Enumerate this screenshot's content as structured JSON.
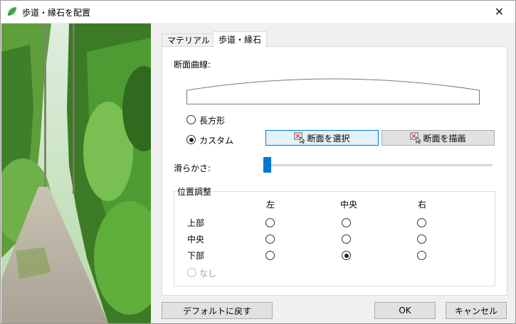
{
  "window": {
    "title": "歩道・縁石を配置",
    "close_glyph": "✕"
  },
  "tabs": [
    {
      "label": "マテリアル",
      "active": false
    },
    {
      "label": "歩道・縁石",
      "active": true
    }
  ],
  "section": {
    "curve_label": "断面曲線:",
    "options": [
      {
        "label": "長方形",
        "checked": false
      },
      {
        "label": "カスタム",
        "checked": true
      }
    ],
    "select_button": "断面を選択",
    "draw_button": "断面を描画",
    "smoothness_label": "滑らかさ:",
    "smoothness_value": 0
  },
  "position": {
    "group_title": "位置調整",
    "columns": [
      "左",
      "中央",
      "右"
    ],
    "rows": [
      "上部",
      "中央",
      "下部"
    ],
    "selected": {
      "row": 2,
      "col": 1
    },
    "none_label": "なし"
  },
  "footer": {
    "default_button": "デフォルトに戻す",
    "ok_button": "OK",
    "cancel_button": "キャンセル"
  },
  "colors": {
    "accent": "#0078d7",
    "app_icon": "#4caf50"
  },
  "icons": [
    "leaf-app-icon",
    "close-icon",
    "select-cursor-icon",
    "draw-cursor-icon"
  ]
}
